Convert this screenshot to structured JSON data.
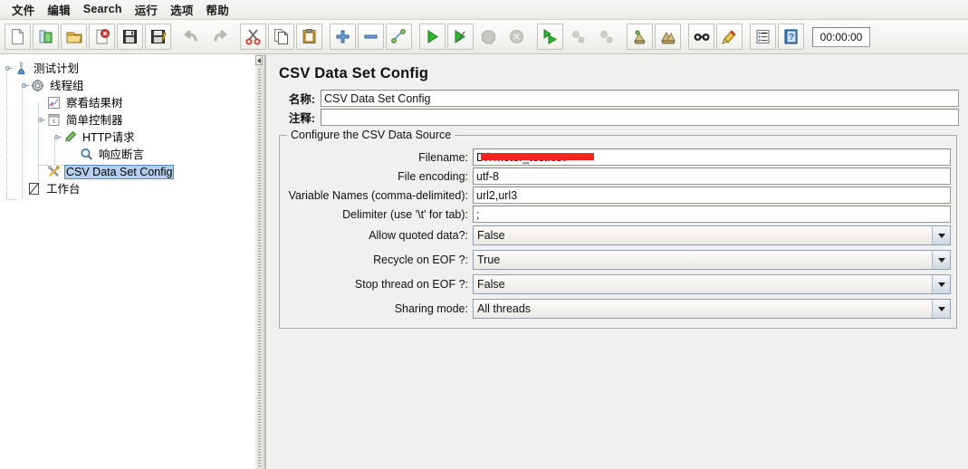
{
  "menubar": {
    "items": [
      {
        "label": "文件",
        "name": "menu-file"
      },
      {
        "label": "编辑",
        "name": "menu-edit"
      },
      {
        "label": "Search",
        "name": "menu-search"
      },
      {
        "label": "运行",
        "name": "menu-run"
      },
      {
        "label": "选项",
        "name": "menu-options"
      },
      {
        "label": "帮助",
        "name": "menu-help"
      }
    ]
  },
  "toolbar": {
    "timer": "00:00:00",
    "buttons": [
      {
        "icon": "new-icon",
        "enabled": true
      },
      {
        "icon": "templates-icon",
        "enabled": true
      },
      {
        "icon": "open-icon",
        "enabled": true
      },
      {
        "icon": "close-icon",
        "enabled": true
      },
      {
        "icon": "save-icon",
        "enabled": true
      },
      {
        "icon": "save-as-icon",
        "enabled": true
      },
      {
        "icon": "undo-icon",
        "enabled": false
      },
      {
        "icon": "redo-icon",
        "enabled": false
      },
      {
        "icon": "cut-icon",
        "enabled": true
      },
      {
        "icon": "copy-icon",
        "enabled": true
      },
      {
        "icon": "paste-icon",
        "enabled": true
      },
      {
        "icon": "expand-all-icon",
        "enabled": true
      },
      {
        "icon": "collapse-all-icon",
        "enabled": true
      },
      {
        "icon": "toggle-icon",
        "enabled": true
      },
      {
        "icon": "start-icon",
        "enabled": true
      },
      {
        "icon": "start-no-pauses-icon",
        "enabled": true
      },
      {
        "icon": "stop-icon",
        "enabled": false
      },
      {
        "icon": "shutdown-icon",
        "enabled": false
      },
      {
        "icon": "remote-start-all-icon",
        "enabled": true
      },
      {
        "icon": "remote-stop-all-icon",
        "enabled": false
      },
      {
        "icon": "remote-shutdown-all-icon",
        "enabled": false
      },
      {
        "icon": "clear-icon",
        "enabled": true
      },
      {
        "icon": "clear-all-icon",
        "enabled": true
      },
      {
        "icon": "search-icon",
        "enabled": true
      },
      {
        "icon": "search-reset-icon",
        "enabled": true
      },
      {
        "icon": "function-helper-icon",
        "enabled": true
      },
      {
        "icon": "help-icon",
        "enabled": true
      }
    ]
  },
  "tree": {
    "nodes": [
      {
        "label": "测试计划",
        "icon": "test-plan-icon",
        "depth": 0,
        "expandable": true,
        "selected": false
      },
      {
        "label": "线程组",
        "icon": "thread-group-icon",
        "depth": 1,
        "expandable": true,
        "selected": false
      },
      {
        "label": "察看结果树",
        "icon": "view-results-tree-icon",
        "depth": 2,
        "expandable": false,
        "selected": false
      },
      {
        "label": "简单控制器",
        "icon": "simple-controller-icon",
        "depth": 2,
        "expandable": true,
        "selected": false
      },
      {
        "label": "HTTP请求",
        "icon": "http-request-icon",
        "depth": 3,
        "expandable": true,
        "selected": false
      },
      {
        "label": "响应断言",
        "icon": "response-assertion-icon",
        "depth": 4,
        "expandable": false,
        "selected": false
      },
      {
        "label": "CSV Data Set Config",
        "icon": "csv-data-set-config-icon",
        "depth": 2,
        "expandable": false,
        "selected": true
      },
      {
        "label": "工作台",
        "icon": "workbench-icon",
        "depth": 0,
        "expandable": false,
        "selected": false
      }
    ]
  },
  "panel": {
    "title": "CSV Data Set Config",
    "name_label": "名称:",
    "name_value": "CSV Data Set Config",
    "comment_label": "注释:",
    "comment_value": "",
    "groupbox_title": "Configure the CSV Data Source",
    "fields": [
      {
        "label": "Filename:",
        "value": "D:\\                         meter_test.csv",
        "redacted": true,
        "type": "text",
        "name": "filename"
      },
      {
        "label": "File encoding:",
        "value": "utf-8",
        "redacted": false,
        "type": "text",
        "name": "file-encoding"
      },
      {
        "label": "Variable Names (comma-delimited):",
        "value": "url2,url3",
        "redacted": false,
        "type": "text",
        "name": "variable-names"
      },
      {
        "label": "Delimiter (use '\\t' for tab):",
        "value": ";",
        "redacted": false,
        "type": "text",
        "name": "delimiter"
      }
    ],
    "dropdowns": [
      {
        "label": "Allow quoted data?:",
        "value": "False",
        "name": "allow-quoted-data"
      },
      {
        "label": "Recycle on EOF ?:",
        "value": "True",
        "name": "recycle-on-eof"
      },
      {
        "label": "Stop thread on EOF ?:",
        "value": "False",
        "name": "stop-thread-on-eof"
      },
      {
        "label": "Sharing mode:",
        "value": "All threads",
        "name": "sharing-mode"
      }
    ]
  },
  "colors": {
    "redaction": "#f5221f",
    "selection": "#b5d0ee",
    "panel_bg": "#f0f0ef"
  }
}
